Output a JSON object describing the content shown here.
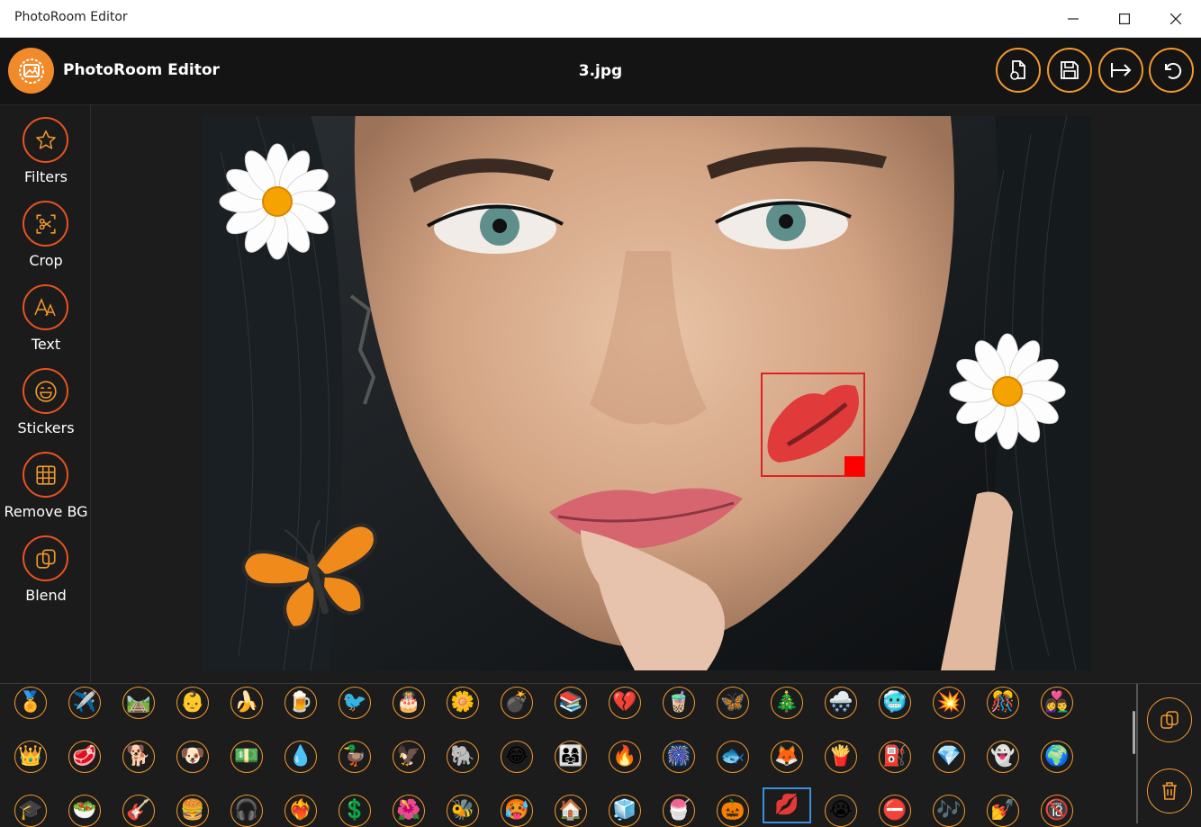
{
  "window": {
    "title": "PhotoRoom Editor"
  },
  "header": {
    "app_title": "PhotoRoom Editor",
    "file_name": "3.jpg"
  },
  "tools": [
    {
      "label": "Filters",
      "icon": "star-icon"
    },
    {
      "label": "Crop",
      "icon": "crop-icon"
    },
    {
      "label": "Text",
      "icon": "text-icon"
    },
    {
      "label": "Stickers",
      "icon": "smiley-icon"
    },
    {
      "label": "Remove BG",
      "icon": "grid-icon"
    },
    {
      "label": "Blend",
      "icon": "blend-icon"
    }
  ],
  "stickers": {
    "row1": [
      "🏅",
      "✈️",
      "🛤️",
      "👶",
      "🍌",
      "🍺",
      "🐦",
      "🎂",
      "🌼",
      "💣",
      "📚",
      "💔",
      "🧋",
      "🦋",
      "🎄",
      "🌨️",
      "🥶",
      "💥",
      "🎊",
      "👩‍❤️‍👨"
    ],
    "row2": [
      "👑",
      "🥩",
      "🐕",
      "🐶",
      "💵",
      "💧",
      "🦆",
      "🦅",
      "🐘",
      "😂",
      "👨‍👩‍👧",
      "🔥",
      "🎆",
      "🐟",
      "🦊",
      "🍟",
      "⛽",
      "💎",
      "👻",
      "🌍"
    ],
    "row3": [
      "🎓",
      "🥗",
      "🎸",
      "🍔",
      "🎧",
      "❤️‍🔥",
      "💲",
      "🌺",
      "🐝",
      "🥵",
      "🏠",
      "🧊",
      "🍧",
      "🎃",
      "💋",
      "😭",
      "⛔",
      "🎶",
      "💅",
      "🔞"
    ],
    "selected": "💋"
  },
  "colors": {
    "accent": "#f39a2b",
    "tool_ring": "#e8531d",
    "selection": "#e02020"
  }
}
